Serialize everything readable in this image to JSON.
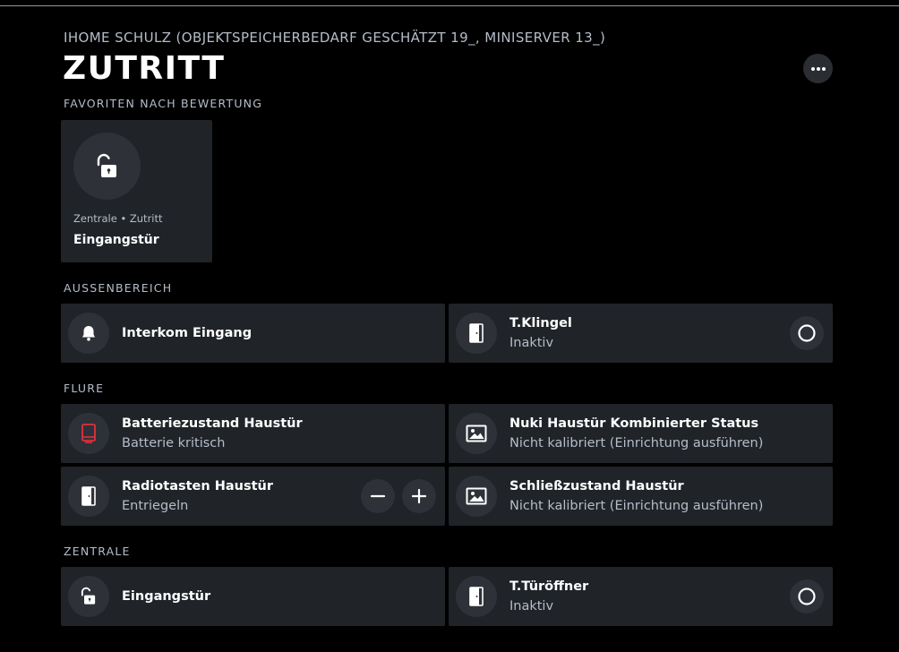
{
  "header": {
    "subtitle": "IHOME SCHULZ (OBJEKTSPEICHERBEDARF GESCHÄTZT 19_, MINISERVER 13_)",
    "title": "ZUTRITT"
  },
  "sections": {
    "favorites": "FAVORITEN NACH BEWERTUNG",
    "outdoor": "AUSSENBEREICH",
    "hallways": "FLURE",
    "central": "ZENTRALE"
  },
  "favorite": {
    "path": "Zentrale • Zutritt",
    "name": "Eingangstür",
    "icon": "lock-open-icon"
  },
  "outdoor_cards": [
    {
      "name": "Interkom Eingang",
      "status": "",
      "icon": "bell-icon"
    },
    {
      "name": "T.Klingel",
      "status": "Inaktiv",
      "icon": "door-icon"
    }
  ],
  "hallway_cards": [
    {
      "name": "Batteriezustand Haustür",
      "status": "Batterie kritisch",
      "icon": "battery-icon"
    },
    {
      "name": "Nuki Haustür Kombinierter Status",
      "status": "Nicht kalibriert (Einrichtung ausführen)",
      "icon": "image-icon"
    },
    {
      "name": "Radiotasten Haustür",
      "status": "Entriegeln",
      "icon": "door-icon"
    },
    {
      "name": "Schließzustand Haustür",
      "status": "Nicht kalibriert (Einrichtung ausführen)",
      "icon": "image-icon"
    }
  ],
  "central_cards": [
    {
      "name": "Eingangstür",
      "status": "",
      "icon": "lock-open-icon"
    },
    {
      "name": "T.Türöffner",
      "status": "Inaktiv",
      "icon": "door-icon"
    }
  ],
  "colors": {
    "background": "#000000",
    "card": "#202328",
    "icon_circle": "#2e3238",
    "text_secondary": "#b4bdc9",
    "battery_alert": "#e0303c"
  }
}
